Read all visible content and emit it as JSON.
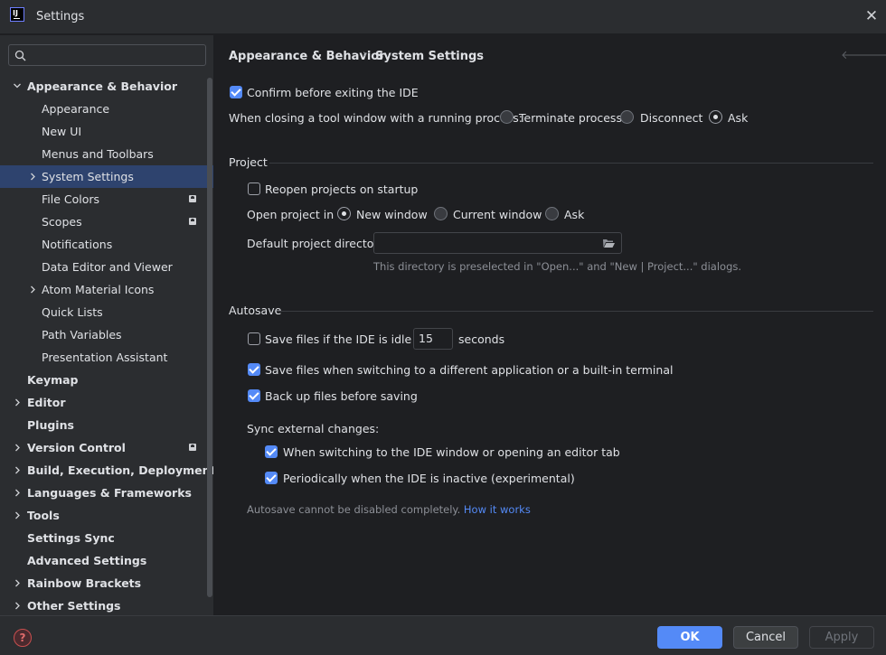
{
  "window": {
    "title": "Settings",
    "logo_text": "IJ"
  },
  "sidebar": {
    "search": {
      "placeholder": ""
    },
    "items": [
      {
        "label": "Appearance & Behavior",
        "arrow": "expanded",
        "bold": true
      },
      {
        "label": "Appearance"
      },
      {
        "label": "New UI"
      },
      {
        "label": "Menus and Toolbars"
      },
      {
        "label": "System Settings",
        "arrow": "collapsed",
        "selected": true
      },
      {
        "label": "File Colors",
        "badge": true
      },
      {
        "label": "Scopes",
        "badge": true
      },
      {
        "label": "Notifications"
      },
      {
        "label": "Data Editor and Viewer"
      },
      {
        "label": "Atom Material Icons",
        "arrow": "collapsed"
      },
      {
        "label": "Quick Lists"
      },
      {
        "label": "Path Variables"
      },
      {
        "label": "Presentation Assistant"
      },
      {
        "label": "Keymap",
        "bold": true
      },
      {
        "label": "Editor",
        "arrow": "collapsed",
        "bold": true
      },
      {
        "label": "Plugins",
        "bold": true
      },
      {
        "label": "Version Control",
        "arrow": "collapsed",
        "bold": true,
        "badge": true
      },
      {
        "label": "Build, Execution, Deployment",
        "arrow": "collapsed",
        "bold": true
      },
      {
        "label": "Languages & Frameworks",
        "arrow": "collapsed",
        "bold": true
      },
      {
        "label": "Tools",
        "arrow": "collapsed",
        "bold": true
      },
      {
        "label": "Settings Sync",
        "bold": true
      },
      {
        "label": "Advanced Settings",
        "bold": true
      },
      {
        "label": "Rainbow Brackets",
        "arrow": "collapsed",
        "bold": true
      },
      {
        "label": "Other Settings",
        "arrow": "collapsed",
        "bold": true
      }
    ]
  },
  "breadcrumb": {
    "parent": "Appearance & Behavior",
    "separator": "›",
    "current": "System Settings"
  },
  "general": {
    "confirm_exit": {
      "label": "Confirm before exiting the IDE",
      "checked": true
    },
    "closing_tool_window": {
      "label": "When closing a tool window with a running process:",
      "options": [
        "Terminate process",
        "Disconnect",
        "Ask"
      ],
      "selected": "Ask"
    }
  },
  "project": {
    "title": "Project",
    "reopen": {
      "label": "Reopen projects on startup",
      "checked": false
    },
    "open_in": {
      "label": "Open project in",
      "options": [
        "New window",
        "Current window",
        "Ask"
      ],
      "selected": "New window"
    },
    "default_dir": {
      "label": "Default project directory:",
      "value": "",
      "hint": "This directory is preselected in \"Open...\" and \"New | Project...\" dialogs."
    }
  },
  "autosave": {
    "title": "Autosave",
    "idle": {
      "label": "Save files if the IDE is idle for",
      "checked": false,
      "value": "15",
      "suffix": "seconds"
    },
    "switching": {
      "label": "Save files when switching to a different application or a built-in terminal",
      "checked": true
    },
    "backup": {
      "label": "Back up files before saving",
      "checked": true
    },
    "sync_title": "Sync external changes:",
    "sync_switch": {
      "label": "When switching to the IDE window or opening an editor tab",
      "checked": true
    },
    "sync_periodic": {
      "label": "Periodically when the IDE is inactive (experimental)",
      "checked": true
    },
    "note": "Autosave cannot be disabled completely.",
    "note_link": "How it works"
  },
  "footer": {
    "help": "?",
    "ok": "OK",
    "cancel": "Cancel",
    "apply": "Apply"
  },
  "colors": {
    "accent": "#548af7",
    "selection": "#2e436e",
    "background": "#1e1f22",
    "panel": "#2b2d30"
  }
}
